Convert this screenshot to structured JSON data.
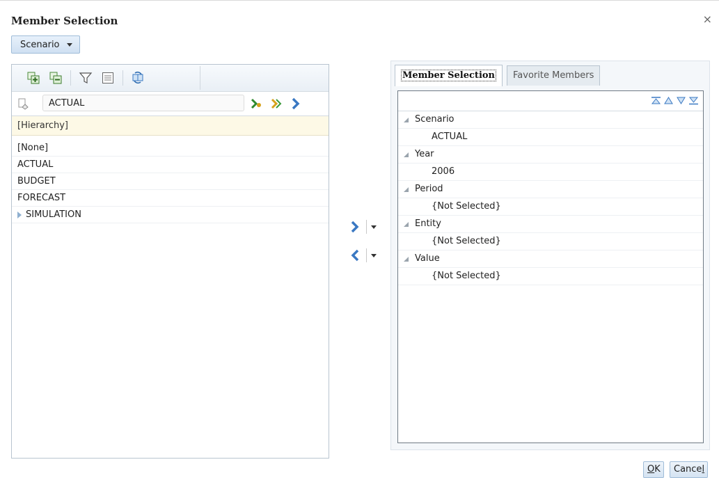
{
  "dialog": {
    "title": "Member Selection",
    "close_glyph": "×"
  },
  "dimension_button": {
    "label": "Scenario"
  },
  "left_panel": {
    "toolbar": [
      "expand-all-icon",
      "collapse-all-icon",
      "filter-icon",
      "properties-icon",
      "refresh-icon"
    ],
    "search": {
      "value": "ACTUAL"
    },
    "hierarchy_label": "[Hierarchy]",
    "members": [
      {
        "label": "[None]",
        "has_children": false
      },
      {
        "label": "ACTUAL",
        "has_children": false
      },
      {
        "label": "BUDGET",
        "has_children": false
      },
      {
        "label": "FORECAST",
        "has_children": false
      },
      {
        "label": "SIMULATION",
        "has_children": true
      }
    ]
  },
  "right_panel": {
    "tabs": [
      {
        "label": "Member Selection",
        "active": true
      },
      {
        "label": "Favorite Members",
        "active": false
      }
    ],
    "tree": [
      {
        "dimension": "Scenario",
        "value": "ACTUAL"
      },
      {
        "dimension": "Year",
        "value": "2006"
      },
      {
        "dimension": "Period",
        "value": "{Not Selected}"
      },
      {
        "dimension": "Entity",
        "value": "{Not Selected}"
      },
      {
        "dimension": "Value",
        "value": "{Not Selected}"
      }
    ]
  },
  "footer": {
    "ok_mnemonic": "O",
    "ok_rest": "K",
    "cancel_rest": "Cance",
    "cancel_mnemonic": "l"
  },
  "colors": {
    "accent": "#3a78c2",
    "icon_green": "#3b9a3b",
    "icon_gold": "#d6a21c"
  }
}
